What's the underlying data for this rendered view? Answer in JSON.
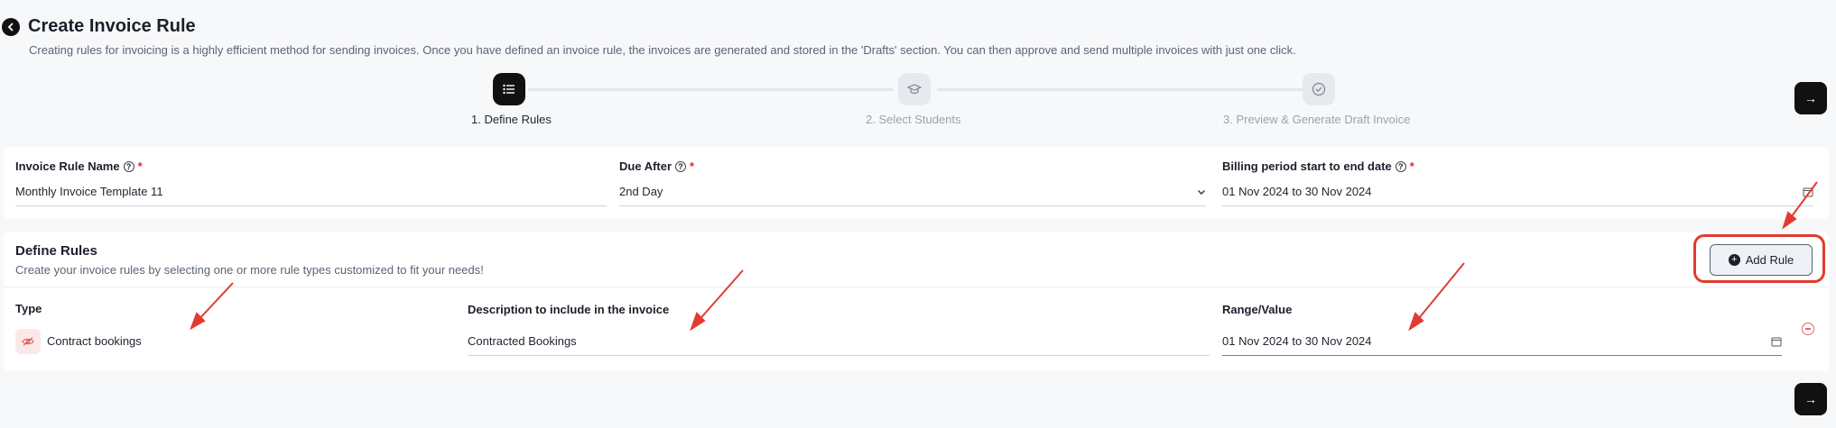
{
  "header": {
    "title": "Create Invoice Rule",
    "description": "Creating rules for invoicing is a highly efficient method for sending invoices. Once you have defined an invoice rule, the invoices are generated and stored in the 'Drafts' section. You can then approve and send multiple invoices with just one click."
  },
  "stepper": {
    "steps": [
      {
        "label": "1. Define Rules",
        "icon": "list-icon",
        "active": true
      },
      {
        "label": "2. Select Students",
        "icon": "graduation-cap-icon",
        "active": false
      },
      {
        "label": "3. Preview & Generate Draft Invoice",
        "icon": "check-circle-icon",
        "active": false
      }
    ]
  },
  "form": {
    "invoice_rule_name": {
      "label": "Invoice Rule Name",
      "value": "Monthly Invoice Template 11"
    },
    "due_after": {
      "label": "Due After",
      "value": "2nd Day"
    },
    "billing_period": {
      "label": "Billing period start to end date",
      "value": "01 Nov 2024 to 30 Nov 2024"
    }
  },
  "rules": {
    "title": "Define Rules",
    "description": "Create your invoice rules by selecting one or more rule types customized to fit your needs!",
    "add_rule_label": "Add Rule",
    "columns": {
      "type": "Type",
      "description": "Description to include in the invoice",
      "range": "Range/Value"
    },
    "rows": [
      {
        "type": "Contract bookings",
        "description": "Contracted Bookings",
        "range": "01 Nov 2024 to 30 Nov 2024"
      }
    ]
  },
  "colors": {
    "accent": "#111111",
    "annotation": "#e23b30",
    "required": "#e0282f"
  }
}
